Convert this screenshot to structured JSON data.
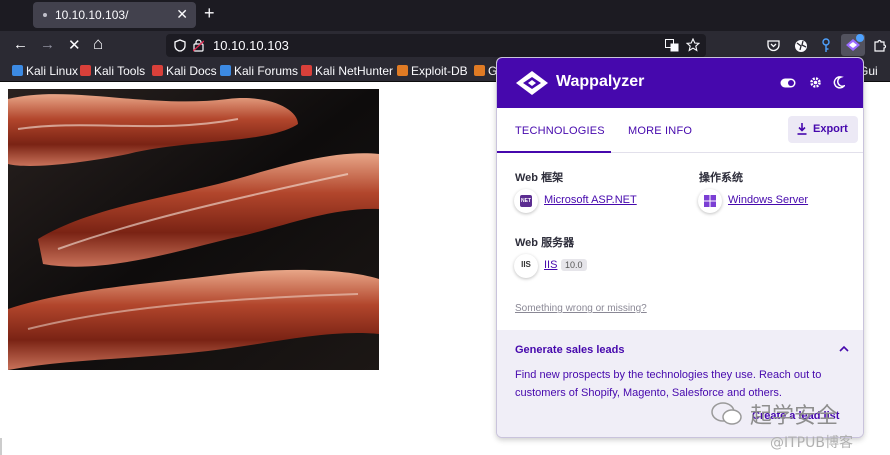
{
  "browser": {
    "tab_title": "10.10.10.103/",
    "close_glyph": "✕",
    "newtab_glyph": "+",
    "url": "10.10.10.103",
    "nav": {
      "back": "←",
      "forward": "→",
      "stop": "✕",
      "home": "⌂"
    }
  },
  "bookmarks": [
    {
      "label": "Kali Linux",
      "color": "#3c8ae3"
    },
    {
      "label": "Kali Tools",
      "color": "#d9403a"
    },
    {
      "label": "Kali Docs",
      "color": "#d9403a"
    },
    {
      "label": "Kali Forums",
      "color": "#3c8ae3"
    },
    {
      "label": "Kali NetHunter",
      "color": "#d9403a"
    },
    {
      "label": "Exploit-DB",
      "color": "#e07b24"
    },
    {
      "label": "G",
      "color": "#e07b24"
    },
    {
      "label": "o Gui",
      "color": "#e07b24"
    }
  ],
  "wappalyzer": {
    "name": "Wappalyzer",
    "tabs": {
      "technologies": "TECHNOLOGIES",
      "more_info": "MORE INFO"
    },
    "export_label": "Export",
    "categories": [
      {
        "name": "Web 框架",
        "tech": "Microsoft ASP.NET",
        "icon": "NET"
      },
      {
        "name": "操作系统",
        "tech": "Windows Server",
        "icon": "win"
      },
      {
        "name": "Web 服务器",
        "tech": "IIS",
        "icon": "IIS",
        "version": "10.0"
      }
    ],
    "wrong_link": "Something wrong or missing?",
    "leads": {
      "title": "Generate sales leads",
      "description": "Find new prospects by the technologies they use. Reach out to customers of Shopify, Magento, Salesforce and others.",
      "button": "Create a lead list"
    },
    "accent": "#4608ad"
  },
  "watermark": {
    "top": "起学安全",
    "bottom": "@ITPUB博客"
  }
}
